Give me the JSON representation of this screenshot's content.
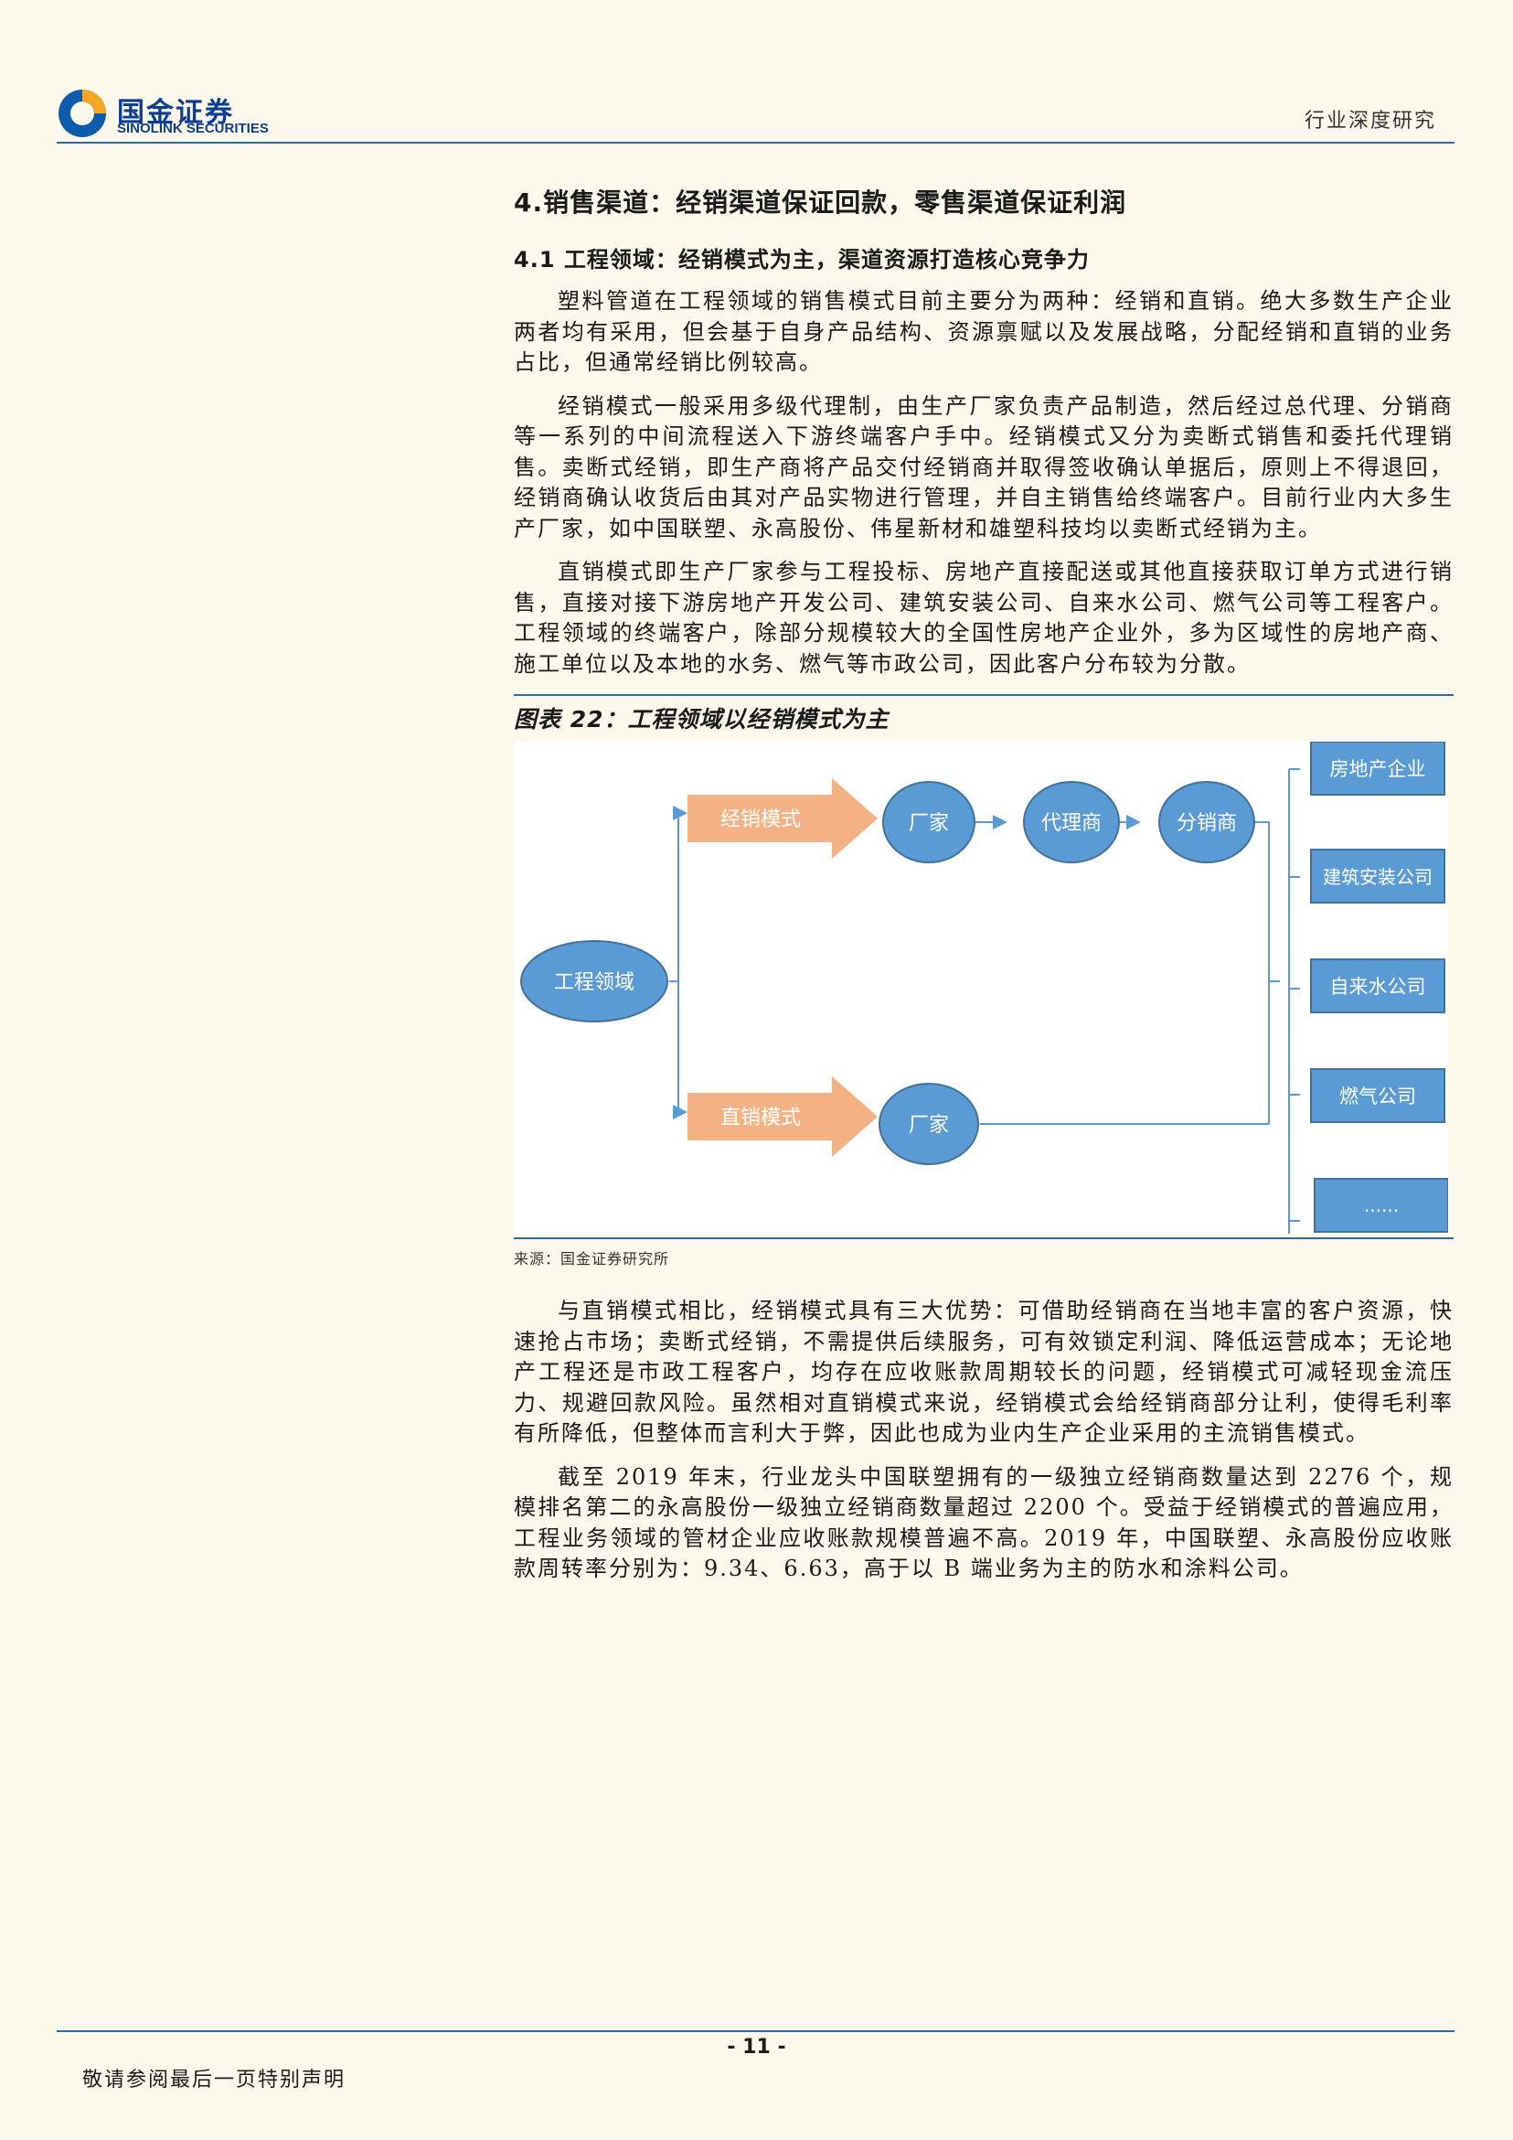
{
  "header": {
    "logo_cn": "国金证券",
    "logo_en": "SINOLINK SECURITIES",
    "category": "行业深度研究"
  },
  "section": {
    "title": "4.销售渠道：经销渠道保证回款，零售渠道保证利润",
    "subtitle": "4.1 工程领域：经销模式为主，渠道资源打造核心竞争力"
  },
  "paragraphs_before": [
    "塑料管道在工程领域的销售模式目前主要分为两种：经销和直销。绝大多数生产企业两者均有采用，但会基于自身产品结构、资源禀赋以及发展战略，分配经销和直销的业务占比，但通常经销比例较高。",
    "经销模式一般采用多级代理制，由生产厂家负责产品制造，然后经过总代理、分销商等一系列的中间流程送入下游终端客户手中。经销模式又分为卖断式销售和委托代理销售。卖断式经销，即生产商将产品交付经销商并取得签收确认单据后，原则上不得退回，经销商确认收货后由其对产品实物进行管理，并自主销售给终端客户。目前行业内大多生产厂家，如中国联塑、永高股份、伟星新材和雄塑科技均以卖断式经销为主。",
    "直销模式即生产厂家参与工程投标、房地产直接配送或其他直接获取订单方式进行销售，直接对接下游房地产开发公司、建筑安装公司、自来水公司、燃气公司等工程客户。工程领域的终端客户，除部分规模较大的全国性房地产企业外，多为区域性的房地产商、施工单位以及本地的水务、燃气等市政公司，因此客户分布较为分散。"
  ],
  "figure": {
    "title": "图表 22：工程领域以经销模式为主",
    "source": "来源：国金证券研究所",
    "root": "工程领域",
    "branch_dist": "经销模式",
    "branch_direct": "直销模式",
    "dist_chain": [
      "厂家",
      "代理商",
      "分销商"
    ],
    "direct_chain": [
      "厂家"
    ],
    "customers": [
      "房地产企业",
      "建筑安装公司",
      "自来水公司",
      "燃气公司",
      "......"
    ],
    "colors": {
      "node": "#5b9bd5",
      "arrow": "#f4b183"
    }
  },
  "paragraphs_after": [
    "与直销模式相比，经销模式具有三大优势：可借助经销商在当地丰富的客户资源，快速抢占市场；卖断式经销，不需提供后续服务，可有效锁定利润、降低运营成本；无论地产工程还是市政工程客户，均存在应收账款周期较长的问题，经销模式可减轻现金流压力、规避回款风险。虽然相对直销模式来说，经销模式会给经销商部分让利，使得毛利率有所降低，但整体而言利大于弊，因此也成为业内生产企业采用的主流销售模式。",
    "截至 2019 年末，行业龙头中国联塑拥有的一级独立经销商数量达到 2276 个，规模排名第二的永高股份一级独立经销商数量超过 2200 个。受益于经销模式的普遍应用，工程业务领域的管材企业应收账款规模普遍不高。2019 年，中国联塑、永高股份应收账款周转率分别为：9.34、6.63，高于以 B 端业务为主的防水和涂料公司。"
  ],
  "footer": {
    "page": "- 11 -",
    "note": "敬请参阅最后一页特别声明"
  }
}
